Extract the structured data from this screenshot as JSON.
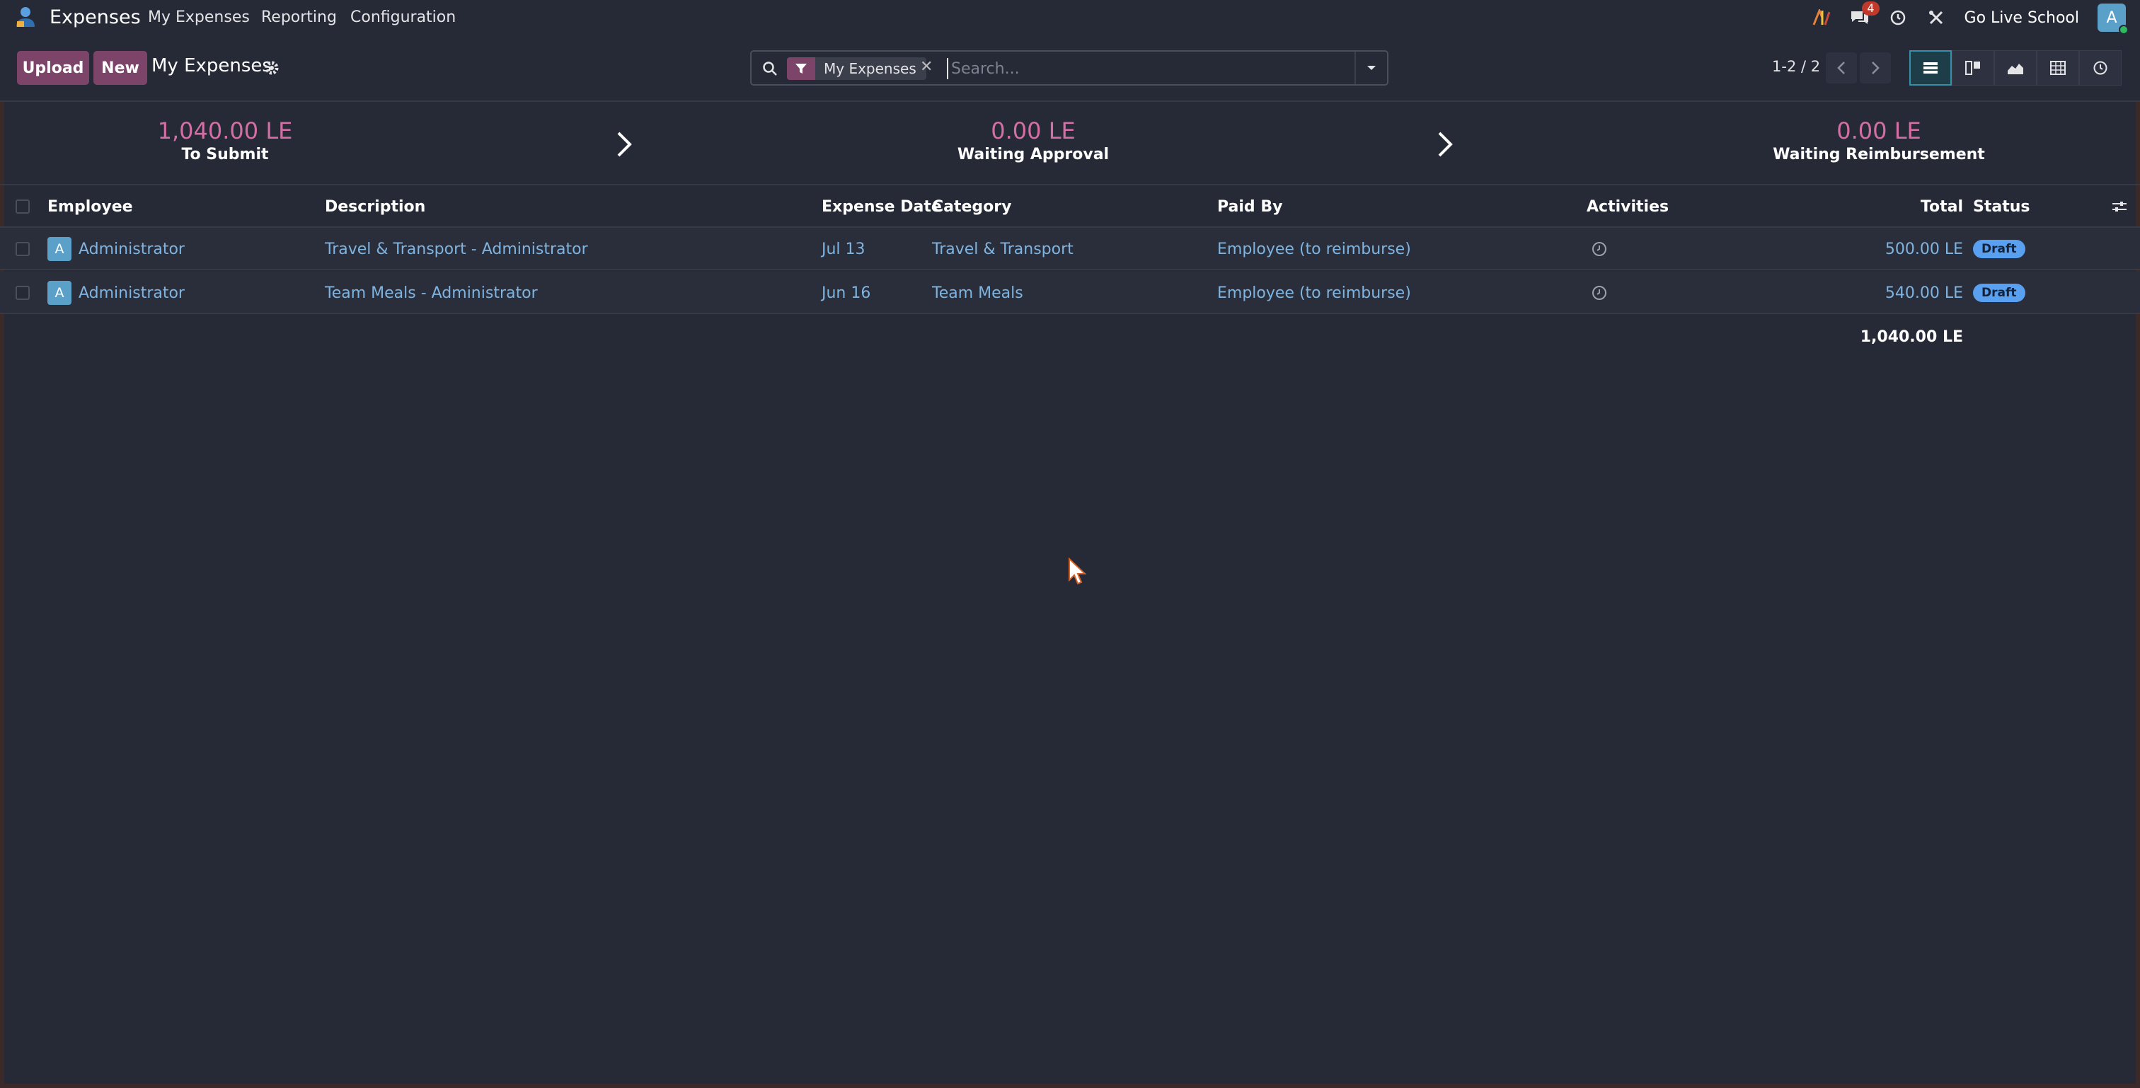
{
  "navbar": {
    "app_name": "Expenses",
    "menus": [
      "My Expenses",
      "Reporting",
      "Configuration"
    ],
    "messages_badge": "4",
    "company": "Go Live School",
    "user_initial": "A"
  },
  "control": {
    "upload_label": "Upload",
    "new_label": "New",
    "title": "My Expenses",
    "facet_label": "My Expenses",
    "search_placeholder": "Search...",
    "pager": "1-2 / 2"
  },
  "summary": [
    {
      "amount": "1,040.00 LE",
      "label": "To Submit"
    },
    {
      "amount": "0.00 LE",
      "label": "Waiting Approval"
    },
    {
      "amount": "0.00 LE",
      "label": "Waiting Reimbursement"
    }
  ],
  "table": {
    "headers": {
      "employee": "Employee",
      "description": "Description",
      "expense_date": "Expense Date",
      "category": "Category",
      "paid_by": "Paid By",
      "activities": "Activities",
      "total": "Total",
      "status": "Status"
    },
    "rows": [
      {
        "avatar": "A",
        "employee": "Administrator",
        "description": "Travel & Transport - Administrator",
        "expense_date": "Jul 13",
        "category": "Travel & Transport",
        "paid_by": "Employee (to reimburse)",
        "total": "500.00 LE",
        "status": "Draft"
      },
      {
        "avatar": "A",
        "employee": "Administrator",
        "description": "Team Meals - Administrator",
        "expense_date": "Jun 16",
        "category": "Team Meals",
        "paid_by": "Employee (to reimburse)",
        "total": "540.00 LE",
        "status": "Draft"
      }
    ],
    "footer_total": "1,040.00 LE"
  }
}
